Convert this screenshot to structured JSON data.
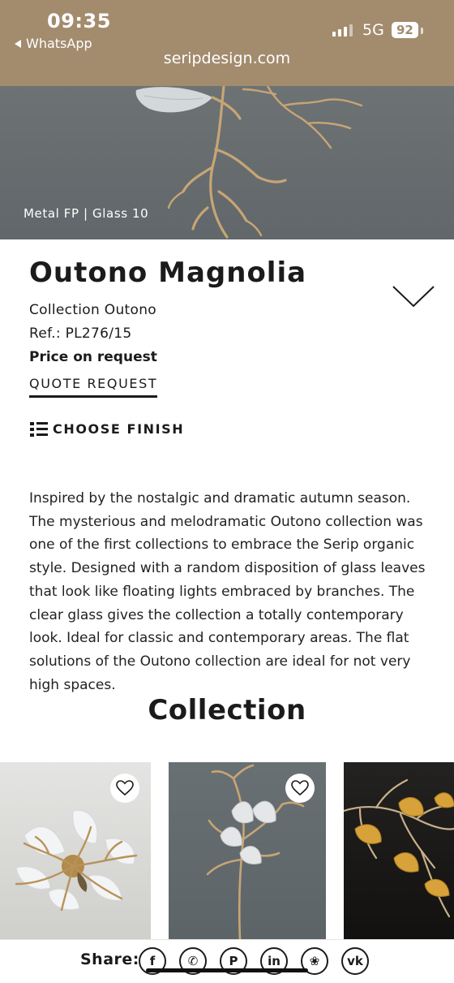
{
  "status_bar": {
    "time": "09:35",
    "back_app": "WhatsApp",
    "network": "5G",
    "battery": "92"
  },
  "browser": {
    "url": "seripdesign.com"
  },
  "hero": {
    "caption": "Metal FP | Glass 10"
  },
  "product": {
    "title": "Outono Magnolia",
    "collection": "Collection Outono",
    "ref": "Ref.: PL276/15",
    "price": "Price on request",
    "quote_label": "QUOTE REQUEST",
    "finish_label": "CHOOSE FINISH",
    "description": "Inspired by the nostalgic and dramatic autumn season. The mysterious and melodramatic Outono collection was one of the first collections to embrace the Serip organic style. Designed with a random disposition of glass leaves that look like floating lights embraced by branches. The clear glass gives the collection a totally contemporary look. Ideal for classic and contemporary areas. The flat solutions of the Outono collection are ideal for not very high spaces."
  },
  "collection_section": {
    "title": "Collection",
    "cards": [
      {
        "image": "ceiling-lamp-glass-leaves",
        "favorite": false
      },
      {
        "image": "wall-lamp-branch-glass-leaves",
        "favorite": false
      },
      {
        "image": "amber-leaves-lamp",
        "favorite": false
      }
    ]
  },
  "share": {
    "label": "Share:",
    "buttons": [
      {
        "name": "facebook",
        "glyph": "f"
      },
      {
        "name": "whatsapp",
        "glyph": "✆"
      },
      {
        "name": "pinterest",
        "glyph": "P"
      },
      {
        "name": "linkedin",
        "glyph": "in"
      },
      {
        "name": "wechat",
        "glyph": "❀"
      },
      {
        "name": "vk",
        "glyph": "vk"
      }
    ]
  },
  "colors": {
    "topbar": "#a38b6e",
    "text": "#1b1b1b",
    "hero_bg": "#6d7274",
    "brass": "#c7a574",
    "amber_glass": "#d8a23a"
  }
}
